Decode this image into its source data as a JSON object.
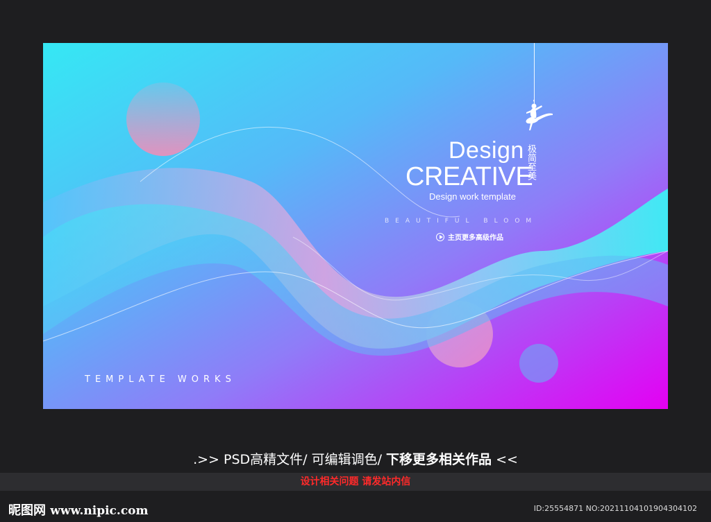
{
  "poster": {
    "title_line1": "Design",
    "title_line2": "CREATIVE",
    "subtitle": "Design work template",
    "vertical_text": "极简至美",
    "tagline": "BEAUTIFUL BLOOM",
    "more_link": "主页更多高级作品",
    "template_works": "TEMPLATE WORKS",
    "icons": {
      "dancer": "ballerina-icon",
      "play": "play-circle-icon"
    },
    "colors": {
      "gradient_start": "#35e8f4",
      "gradient_mid": "#8f7cf8",
      "gradient_end": "#e400f3"
    }
  },
  "caption": {
    "prefix": ".>> PSD高精文件/  可编辑调色/  ",
    "bold": "下移更多相关作品",
    "suffix": " <<"
  },
  "notice": "设计相关问题 请发站内信",
  "footer": {
    "logo_cn": "昵图网",
    "logo_url": "www.nipic.com",
    "id_text": "ID:25554871 NO:20211104101904304102"
  }
}
